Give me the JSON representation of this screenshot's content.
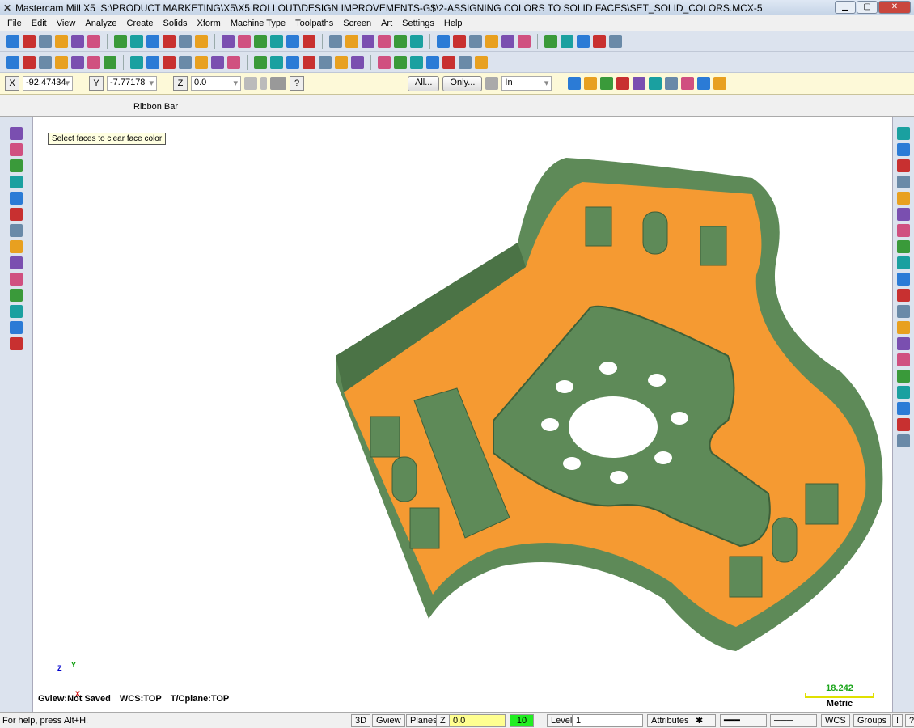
{
  "title": {
    "app": "Mastercam Mill X5",
    "path": "S:\\PRODUCT MARKETING\\X5\\X5 ROLLOUT\\DESIGN IMPROVEMENTS-G$\\2-ASSIGNING COLORS TO SOLID FACES\\SET_SOLID_COLORS.MCX-5"
  },
  "menu": [
    "File",
    "Edit",
    "View",
    "Analyze",
    "Create",
    "Solids",
    "Xform",
    "Machine Type",
    "Toolpaths",
    "Screen",
    "Art",
    "Settings",
    "Help"
  ],
  "toolbar1": [
    "new-file-icon",
    "open-icon",
    "save-icon",
    "print-icon",
    "print-preview-icon",
    "trophy-icon",
    "undo-icon",
    "redo-icon",
    "pan-icon",
    "zoom-fit-icon",
    "zoom-window-icon",
    "zoom-target-icon",
    "zoom-in-icon",
    "unzoom-icon",
    "zoom-out-icon",
    "view-icon",
    "view2-icon",
    "view3-icon",
    "cube-iso-icon",
    "cube-top-icon",
    "cube-front-icon",
    "cube-side-icon",
    "solid-icon",
    "sphere-icon",
    "globe-icon",
    "shade-icon",
    "wire-icon",
    "pen-icon",
    "pen2-icon",
    "brush-icon",
    "analyze-icon",
    "toolpath-icon",
    "tool2-icon",
    "tool3-icon",
    "tool4-icon"
  ],
  "toolbar2": [
    "point-icon",
    "line-icon",
    "circle-icon",
    "rectangle-icon",
    "fillet-icon",
    "chain-icon",
    "cylinder-icon",
    "trim-icon",
    "break-icon",
    "xform1-icon",
    "xform2-icon",
    "xform3-icon",
    "xform4-icon",
    "xform5-icon",
    "xform6-icon",
    "xform7-icon",
    "solid-extrude-icon",
    "grid-icon",
    "stretch-icon",
    "measure-icon",
    "analyze-dist-icon",
    "table-icon",
    "list-icon",
    "surface-icon",
    "brush-icon",
    "gear-icon",
    "settings-icon",
    "tool-icon"
  ],
  "ribbon": {
    "x_value": "-92.47434",
    "y_value": "-7.77178",
    "z_value": "0.0",
    "all_label": "All...",
    "only_label": "Only...",
    "mode_value": "In",
    "x_label": "X",
    "y_label": "Y",
    "z_label": "Z",
    "help": "?"
  },
  "ribbon_bar_label": "Ribbon Bar",
  "left_toolbar": [
    "solid-extrude-icon",
    "revolve-icon",
    "sweep-icon",
    "loft-icon",
    "fillet-icon",
    "chamfer-icon",
    "shell-icon",
    "trim-icon",
    "boolean-add-icon",
    "boolean-remove-icon",
    "draft-icon",
    "layout-icon",
    "manager-icon",
    "solid-properties-icon"
  ],
  "right_toolbar": [
    "select-icon",
    "select2-icon",
    "select3-icon",
    "grid-color-icon",
    "faces-icon",
    "globe-icon",
    "wireframe-icon",
    "plus-icon",
    "light-icon",
    "circle-icon",
    "undo-icon",
    "grid-icon",
    "cube-icon",
    "sphere-icon",
    "cancel-icon",
    "color-icon",
    "color2-icon",
    "color3-icon",
    "palette-icon",
    "arrow-icon"
  ],
  "viewport": {
    "tooltip": "Select faces to clear face color",
    "gview": "Gview:Not Saved",
    "wcs": "WCS:TOP",
    "tcplane": "T/Cplane:TOP",
    "scale_value": "18.242",
    "scale_unit": "Metric",
    "axis_z": "Z",
    "axis_y": "Y",
    "axis_x": "X"
  },
  "colors": {
    "part_green": "#5e8a58",
    "floor_orange": "#f59a32"
  },
  "status": {
    "help": "For help, press Alt+H.",
    "b3d": "3D",
    "gview": "Gview",
    "planes": "Planes",
    "z": "Z",
    "z_value": "0.0",
    "color_value": "10",
    "level_label": "Level",
    "level_value": "1",
    "attributes": "Attributes",
    "wcs": "WCS",
    "groups": "Groups",
    "bang": "!",
    "question": "?"
  }
}
